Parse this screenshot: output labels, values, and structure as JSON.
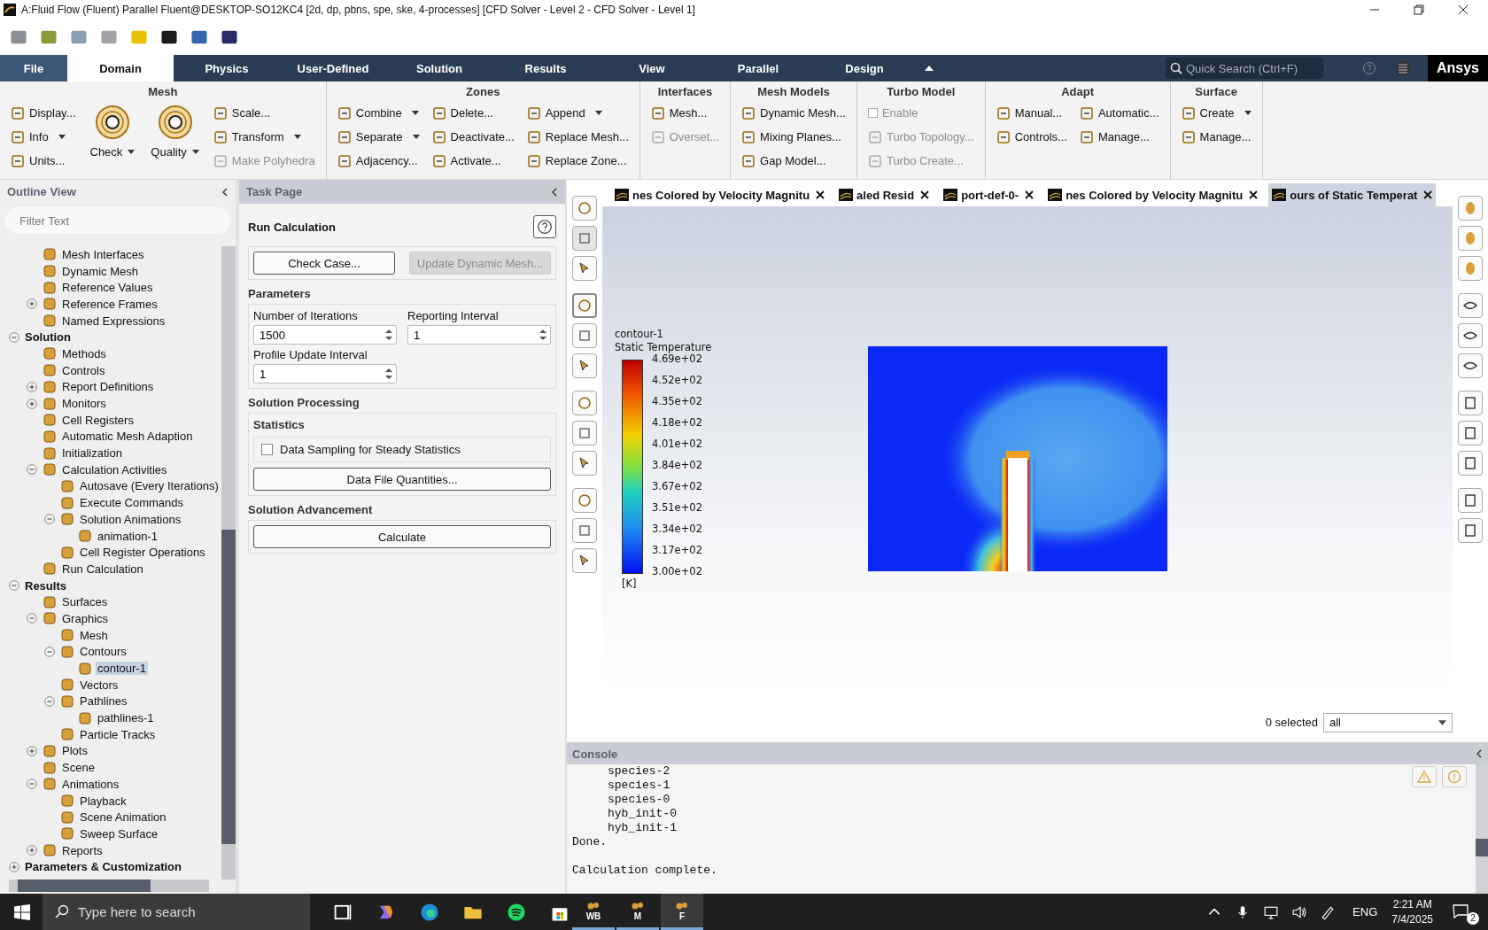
{
  "window": {
    "title": "A:Fluid Flow (Fluent) Parallel Fluent@DESKTOP-SO12KC4  [2d, dp, pbns, spe, ske, 4-processes] [CFD Solver - Level 2 - CFD Solver - Level 1]"
  },
  "ribbon": {
    "tabs": [
      {
        "label": "File",
        "selected": false,
        "kind": "file"
      },
      {
        "label": "Domain",
        "selected": true,
        "kind": "tab"
      },
      {
        "label": "Physics",
        "selected": false,
        "kind": "tab"
      },
      {
        "label": "User-Defined",
        "selected": false,
        "kind": "tab"
      },
      {
        "label": "Solution",
        "selected": false,
        "kind": "tab"
      },
      {
        "label": "Results",
        "selected": false,
        "kind": "tab"
      },
      {
        "label": "View",
        "selected": false,
        "kind": "tab"
      },
      {
        "label": "Parallel",
        "selected": false,
        "kind": "tab"
      },
      {
        "label": "Design",
        "selected": false,
        "kind": "tab"
      }
    ],
    "search": {
      "placeholder": "Quick Search (Ctrl+F)"
    },
    "brand": "Ansys",
    "groups": [
      {
        "title": "Mesh",
        "columns": [
          [
            {
              "kind": "small",
              "label": "Display...",
              "disabled": false,
              "menu": false
            },
            {
              "kind": "small",
              "label": "Info",
              "disabled": false,
              "menu": true
            },
            {
              "kind": "small",
              "label": "Units...",
              "disabled": false,
              "menu": false
            }
          ],
          [
            {
              "kind": "large",
              "label": "Check",
              "disabled": false,
              "menu": true
            }
          ],
          [
            {
              "kind": "large",
              "label": "Quality",
              "disabled": false,
              "menu": true
            }
          ],
          [
            {
              "kind": "small",
              "label": "Scale...",
              "disabled": false,
              "menu": false
            },
            {
              "kind": "small",
              "label": "Transform",
              "disabled": false,
              "menu": true
            },
            {
              "kind": "small",
              "label": "Make Polyhedra",
              "disabled": true,
              "menu": false
            }
          ]
        ]
      },
      {
        "title": "Zones",
        "columns": [
          [
            {
              "kind": "small",
              "label": "Combine",
              "disabled": false,
              "menu": true
            },
            {
              "kind": "small",
              "label": "Separate",
              "disabled": false,
              "menu": true
            },
            {
              "kind": "small",
              "label": "Adjacency...",
              "disabled": false,
              "menu": false
            }
          ],
          [
            {
              "kind": "small",
              "label": "Delete...",
              "disabled": false,
              "menu": false
            },
            {
              "kind": "small",
              "label": "Deactivate...",
              "disabled": false,
              "menu": false
            },
            {
              "kind": "small",
              "label": "Activate...",
              "disabled": false,
              "menu": false
            }
          ],
          [
            {
              "kind": "small",
              "label": "Append",
              "disabled": false,
              "menu": true
            },
            {
              "kind": "small",
              "label": "Replace Mesh...",
              "disabled": false,
              "menu": false
            },
            {
              "kind": "small",
              "label": "Replace Zone...",
              "disabled": false,
              "menu": false
            }
          ]
        ]
      },
      {
        "title": "Interfaces",
        "columns": [
          [
            {
              "kind": "small",
              "label": "Mesh...",
              "disabled": false,
              "menu": false
            },
            {
              "kind": "small",
              "label": "Overset...",
              "disabled": true,
              "menu": false
            }
          ]
        ]
      },
      {
        "title": "Mesh Models",
        "columns": [
          [
            {
              "kind": "small",
              "label": "Dynamic Mesh...",
              "disabled": false,
              "menu": false
            },
            {
              "kind": "small",
              "label": "Mixing Planes...",
              "disabled": false,
              "menu": false
            },
            {
              "kind": "small",
              "label": "Gap Model...",
              "disabled": false,
              "menu": false
            }
          ]
        ]
      },
      {
        "title": "Turbo Model",
        "columns": [
          [
            {
              "kind": "checkbox",
              "label": "Enable",
              "disabled": true,
              "checked": false
            },
            {
              "kind": "small",
              "label": "Turbo Topology...",
              "disabled": true,
              "menu": false
            },
            {
              "kind": "small",
              "label": "Turbo Create...",
              "disabled": true,
              "menu": false
            }
          ]
        ]
      },
      {
        "title": "Adapt",
        "columns": [
          [
            {
              "kind": "small",
              "label": "Manual...",
              "disabled": false,
              "menu": false
            },
            {
              "kind": "small",
              "label": "Controls...",
              "disabled": false,
              "menu": false
            }
          ],
          [
            {
              "kind": "small",
              "label": "Automatic...",
              "disabled": false,
              "menu": false
            },
            {
              "kind": "small",
              "label": "Manage...",
              "disabled": false,
              "menu": false
            }
          ]
        ]
      },
      {
        "title": "Surface",
        "columns": [
          [
            {
              "kind": "small",
              "label": "Create",
              "disabled": false,
              "menu": true
            },
            {
              "kind": "small",
              "label": "Manage...",
              "disabled": false,
              "menu": false
            }
          ]
        ]
      }
    ]
  },
  "outline": {
    "title": "Outline View",
    "filter": {
      "placeholder": "Filter Text"
    },
    "tree": [
      {
        "children": [
          {
            "label": "Mesh Interfaces",
            "selected": false
          },
          {
            "label": "Dynamic Mesh",
            "selected": false
          },
          {
            "label": "Reference Values",
            "selected": false
          },
          {
            "label": "Reference Frames",
            "selected": false,
            "expanded": false
          },
          {
            "label": "Named Expressions",
            "selected": false
          }
        ]
      },
      {
        "label": "Solution",
        "selected": false,
        "expanded": true,
        "children": [
          {
            "label": "Methods",
            "selected": false
          },
          {
            "label": "Controls",
            "selected": false
          },
          {
            "label": "Report Definitions",
            "selected": false,
            "expanded": false
          },
          {
            "label": "Monitors",
            "selected": false,
            "expanded": false
          },
          {
            "label": "Cell Registers",
            "selected": false
          },
          {
            "label": "Automatic Mesh Adaption",
            "selected": false
          },
          {
            "label": "Initialization",
            "selected": false
          },
          {
            "label": "Calculation Activities",
            "selected": false,
            "expanded": true,
            "children": [
              {
                "label": "Autosave (Every Iterations)",
                "selected": false
              },
              {
                "label": "Execute Commands",
                "selected": false
              },
              {
                "label": "Solution Animations",
                "selected": false,
                "expanded": true,
                "children": [
                  {
                    "label": "animation-1",
                    "selected": false
                  }
                ]
              },
              {
                "label": "Cell Register Operations",
                "selected": false
              }
            ]
          },
          {
            "label": "Run Calculation",
            "selected": false
          }
        ]
      },
      {
        "label": "Results",
        "selected": false,
        "expanded": true,
        "children": [
          {
            "label": "Surfaces",
            "selected": false
          },
          {
            "label": "Graphics",
            "selected": false,
            "expanded": true,
            "children": [
              {
                "label": "Mesh",
                "selected": false
              },
              {
                "label": "Contours",
                "selected": false,
                "expanded": true,
                "children": [
                  {
                    "label": "contour-1",
                    "selected": true
                  }
                ]
              },
              {
                "label": "Vectors",
                "selected": false
              },
              {
                "label": "Pathlines",
                "selected": false,
                "expanded": true,
                "children": [
                  {
                    "label": "pathlines-1",
                    "selected": false
                  }
                ]
              },
              {
                "label": "Particle Tracks",
                "selected": false
              }
            ]
          },
          {
            "label": "Plots",
            "selected": false,
            "expanded": false
          },
          {
            "label": "Scene",
            "selected": false
          },
          {
            "label": "Animations",
            "selected": false,
            "expanded": true,
            "children": [
              {
                "label": "Playback",
                "selected": false
              },
              {
                "label": "Scene Animation",
                "selected": false
              },
              {
                "label": "Sweep Surface",
                "selected": false
              }
            ]
          },
          {
            "label": "Reports",
            "selected": false,
            "expanded": false
          }
        ]
      },
      {
        "label": "Parameters & Customization",
        "selected": false,
        "expanded": false
      }
    ]
  },
  "task_page": {
    "title": "Task Page",
    "heading": "Run Calculation",
    "top_buttons": [
      {
        "label": "Check Case...",
        "disabled": false
      },
      {
        "label": "Update Dynamic Mesh...",
        "disabled": true
      }
    ],
    "parameters": {
      "title": "Parameters",
      "fields": [
        {
          "label": "Number of Iterations",
          "value": "1500"
        },
        {
          "label": "Reporting Interval",
          "value": "1"
        },
        {
          "label": "Profile Update Interval",
          "value": "1"
        }
      ]
    },
    "processing": {
      "title": "Solution Processing",
      "statistics": {
        "title": "Statistics",
        "checkbox": {
          "label": "Data Sampling for Steady Statistics",
          "checked": false
        }
      },
      "button": "Data File Quantities..."
    },
    "advancement": {
      "title": "Solution Advancement",
      "button": "Calculate"
    }
  },
  "graphics": {
    "tabs": [
      {
        "label": "nes Colored by Velocity Magnitu",
        "selected": false
      },
      {
        "label": "aled Resid",
        "selected": false
      },
      {
        "label": "port-def-0-",
        "selected": false
      },
      {
        "label": "nes Colored by Velocity Magnitu",
        "selected": false
      },
      {
        "label": "ours of Static Temperat",
        "selected": true
      }
    ],
    "legend": {
      "name": "contour-1",
      "quantity": "Static Temperature",
      "labels": [
        "4.69e+02",
        "4.52e+02",
        "4.35e+02",
        "4.18e+02",
        "4.01e+02",
        "3.84e+02",
        "3.67e+02",
        "3.51e+02",
        "3.34e+02",
        "3.17e+02",
        "3.00e+02"
      ],
      "unit": "[K]"
    },
    "selection": {
      "count": "0 selected",
      "filter": "all"
    }
  },
  "console": {
    "title": "Console",
    "lines": [
      {
        "text": "species-2",
        "indent": true
      },
      {
        "text": "species-1",
        "indent": true
      },
      {
        "text": "species-0",
        "indent": true
      },
      {
        "text": "hyb_init-0",
        "indent": true
      },
      {
        "text": "hyb_init-1",
        "indent": true
      },
      {
        "text": "Done.",
        "indent": false
      },
      {
        "text": "Calculation complete.",
        "indent": false,
        "gap": true
      }
    ]
  },
  "taskbar": {
    "search": {
      "placeholder": "Type here to search"
    },
    "apps": [
      {
        "label": "WB",
        "selected": false
      },
      {
        "label": "M",
        "selected": false
      },
      {
        "label": "F",
        "selected": true
      }
    ],
    "language": "ENG",
    "time": "2:21 AM",
    "date": "7/4/2025",
    "notifications": "2"
  }
}
